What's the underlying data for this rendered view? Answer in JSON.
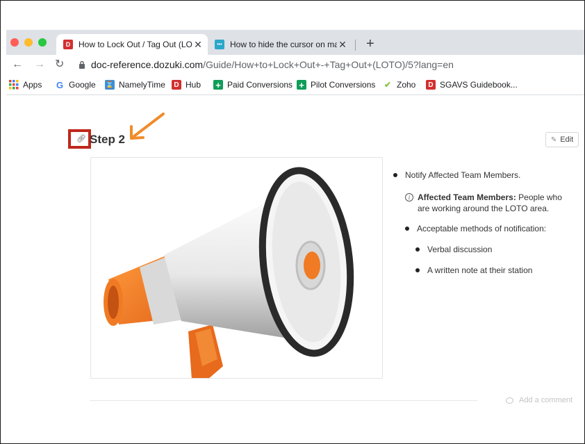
{
  "tabs": [
    {
      "favicon": "D",
      "favicon_color": "#d32f2f",
      "title": "How to Lock Out / Tag Out (LOTO",
      "close": "✕",
      "active": true
    },
    {
      "favicon": "•••",
      "favicon_color": "#2aa7c9",
      "title": "How to hide the cursor on macO",
      "close": "✕",
      "active": false
    }
  ],
  "new_tab": "+",
  "nav": {
    "back": "←",
    "forward": "→",
    "reload": "↻"
  },
  "url": {
    "host": "doc-reference.dozuki.com",
    "path": "/Guide/How+to+Lock+Out+-+Tag+Out+(LOTO)/5?lang=en"
  },
  "bookmarks": [
    {
      "icon": "apps-grid-icon",
      "label": "Apps"
    },
    {
      "icon": "google-icon",
      "glyph": "G",
      "label": "Google"
    },
    {
      "icon": "namelytime-icon",
      "glyph": "⌛",
      "label": "NamelyTime"
    },
    {
      "icon": "dozuki-icon",
      "glyph": "D",
      "label": "Hub"
    },
    {
      "icon": "sheets-icon",
      "glyph": "+",
      "label": "Paid Conversions"
    },
    {
      "icon": "sheets-icon",
      "glyph": "+",
      "label": "Pilot Conversions"
    },
    {
      "icon": "zoho-icon",
      "glyph": "✔",
      "label": "Zoho"
    },
    {
      "icon": "dozuki-icon",
      "glyph": "D",
      "label": "SGAVS Guidebook..."
    }
  ],
  "step": {
    "title": "Step 2",
    "anchor_icon": "link-icon"
  },
  "edit_label": "Edit",
  "bullets": [
    {
      "text": "Notify Affected Team Members."
    },
    {
      "bold": "Affected Team Members:",
      "text": " People who are working around the LOTO area."
    },
    {
      "text": "Acceptable methods of notification:"
    },
    {
      "text": "Verbal discussion"
    },
    {
      "text": "A written note at their station"
    }
  ],
  "comment_label": "Add a comment",
  "colors": {
    "accent_red": "#c0271c",
    "arrow_orange": "#f08c2a",
    "tabstrip": "#dee1e6"
  }
}
